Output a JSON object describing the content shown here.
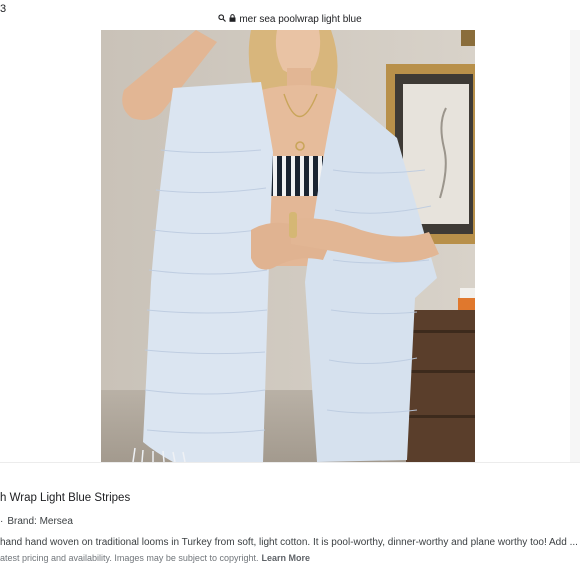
{
  "browser": {
    "tab_count": "3",
    "search_query": "mer sea poolwrap light blue",
    "search_icon": "search-icon",
    "lock_icon": "lock-icon"
  },
  "product": {
    "title": "h Wrap Light Blue Stripes",
    "brand_line": "Brand: Mersea",
    "description": "hand hand woven on traditional looms in Turkey from soft, light cotton. It is pool-worthy, dinner-worthy and plane worthy too! Add ...",
    "disclaimer": "atest pricing and availability. Images may be subject to copyright.",
    "learn_more": "Learn More"
  },
  "colors": {
    "wrap_blue": "#dbe5f1",
    "wall": "#cfc6bd",
    "link_gray": "#5f6368"
  }
}
